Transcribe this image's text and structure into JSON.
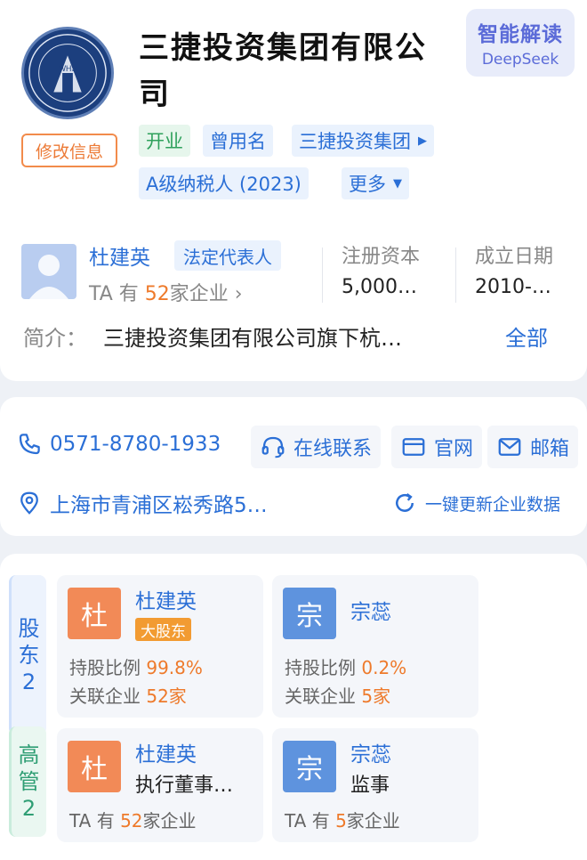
{
  "company": {
    "name": "三捷投资集团有限公司",
    "logo_text": "WHS",
    "edit_label": "修改信息",
    "ai": {
      "title": "智能解读",
      "subtitle": "DeepSeek"
    },
    "tags": {
      "status": "开业",
      "former_label": "曾用名",
      "former_value": "三捷投资集团",
      "taxpayer": "A级纳税人 (2023)",
      "more": "更多"
    }
  },
  "legal_rep": {
    "name": "杜建英",
    "role": "法定代表人",
    "sub_prefix": "TA 有 ",
    "sub_count": "52",
    "sub_suffix": "家企业 ›"
  },
  "stats": {
    "capital_label": "注册资本",
    "capital_value": "5,000…",
    "date_label": "成立日期",
    "date_value": "2010-…"
  },
  "intro": {
    "label": "简介：",
    "text": "三捷投资集团有限公司旗下杭…",
    "all": "全部"
  },
  "contact": {
    "phone": "0571-8780-1933",
    "online": "在线联系",
    "website": "官网",
    "email": "邮箱",
    "address": "上海市青浦区崧秀路5…",
    "refresh": "一键更新企业数据"
  },
  "shareholders": {
    "tab": [
      "股",
      "东",
      "2"
    ],
    "items": [
      {
        "avatar_char": "杜",
        "name": "杜建英",
        "badge": "大股东",
        "ratio_label": "持股比例 ",
        "ratio": "99.8%",
        "rel_label": "关联企业 ",
        "rel": "52家"
      },
      {
        "avatar_char": "宗",
        "name": "宗蕊",
        "ratio_label": "持股比例 ",
        "ratio": "0.2%",
        "rel_label": "关联企业 ",
        "rel": "5家"
      }
    ]
  },
  "executives": {
    "tab": [
      "高",
      "管",
      "2"
    ],
    "items": [
      {
        "avatar_char": "杜",
        "name": "杜建英",
        "role": "执行董事…",
        "prefix": "TA 有 ",
        "count": "52",
        "suffix": "家企业"
      },
      {
        "avatar_char": "宗",
        "name": "宗蕊",
        "role": "监事",
        "prefix": "TA 有 ",
        "count": "5",
        "suffix": "家企业"
      }
    ]
  },
  "colors": {
    "accent_blue": "#2b6fd6",
    "accent_orange": "#ee7a2b",
    "status_green": "#2fa15c"
  }
}
